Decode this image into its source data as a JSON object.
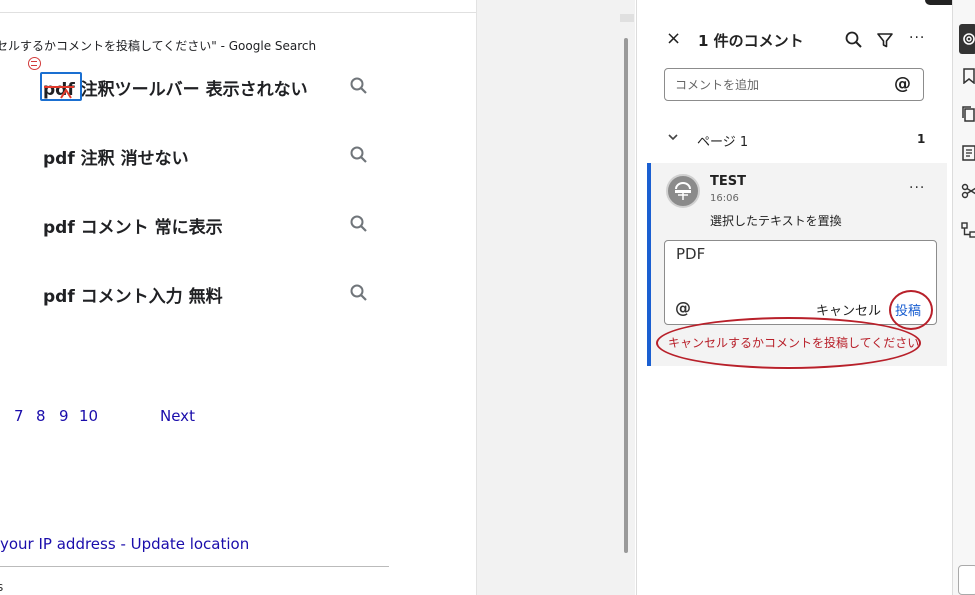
{
  "document": {
    "header_text": "セルするかコメントを投稿してください\" - Google Search",
    "suggestions": [
      {
        "text": "pdf 注釈ツールバー 表示されない"
      },
      {
        "text": "pdf 注釈 消せない"
      },
      {
        "text": "pdf コメント 常に表示"
      },
      {
        "text": "pdf コメント入力 無料"
      }
    ],
    "pagination": {
      "pages": [
        "7",
        "8",
        "9",
        "10"
      ],
      "next": "Next"
    },
    "location": {
      "prefix": "your IP address",
      "sep": " - ",
      "link": "Update location"
    },
    "bottom_char": "s"
  },
  "comments_panel": {
    "close": "×",
    "title": "1 件のコメント",
    "icons": [
      "search-icon",
      "filter-icon",
      "more-icon"
    ],
    "more": "···",
    "add_placeholder": "コメントを追加",
    "at_symbol": "@",
    "page_section": {
      "label": "ページ 1",
      "count": "1"
    },
    "comment": {
      "author": "TEST",
      "time": "16:06",
      "text": "選択したテキストを置換",
      "more": "···",
      "reply_value": "PDF",
      "reply_at": "@",
      "cancel_label": "キャンセル",
      "post_label": "投稿",
      "error_text": "キャンセルするかコメントを投稿してください"
    }
  },
  "colors": {
    "accent": "#1a5fd1",
    "error": "#b8202a",
    "link": "#1a0dab"
  }
}
